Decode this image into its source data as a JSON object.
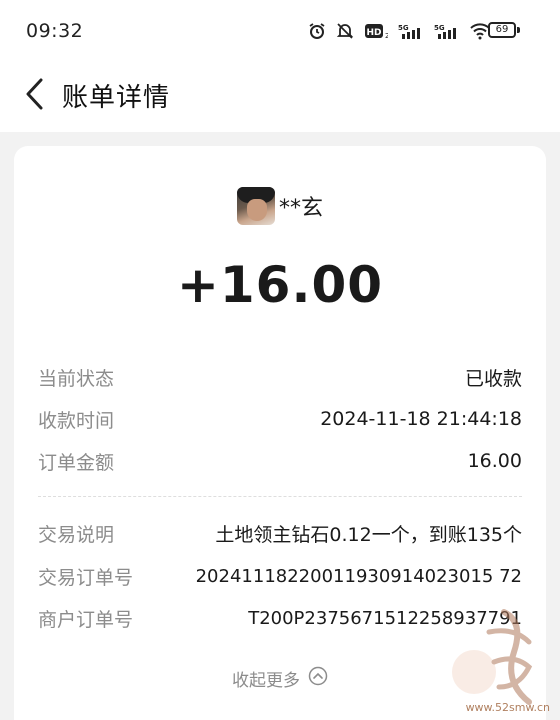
{
  "status_bar": {
    "time": "09:32",
    "network_1": "5G",
    "network_2": "5G",
    "hd_label": "HD",
    "battery": "69"
  },
  "nav": {
    "title": "账单详情",
    "back_icon": "chevron-left-icon"
  },
  "transaction": {
    "payer_name": "**玄",
    "amount": "+16.00"
  },
  "details": [
    {
      "label": "当前状态",
      "value": "已收款"
    },
    {
      "label": "收款时间",
      "value": "2024-11-18 21:44:18"
    },
    {
      "label": "订单金额",
      "value": "16.00"
    }
  ],
  "extra_details": [
    {
      "label": "交易说明",
      "value": "土地领主钻石0.12一个，到账135个"
    },
    {
      "label": "交易订单号",
      "value": "20241118220011930914023015 72"
    },
    {
      "label": "商户订单号",
      "value": "T200P2375671512258937791"
    }
  ],
  "collapse": {
    "label": "收起更多"
  },
  "watermark": {
    "url": "www.52smw.cn"
  },
  "colors": {
    "label_gray": "#8c8c8c",
    "text_dark": "#1a1a1a",
    "background": "#f2f2f2"
  }
}
